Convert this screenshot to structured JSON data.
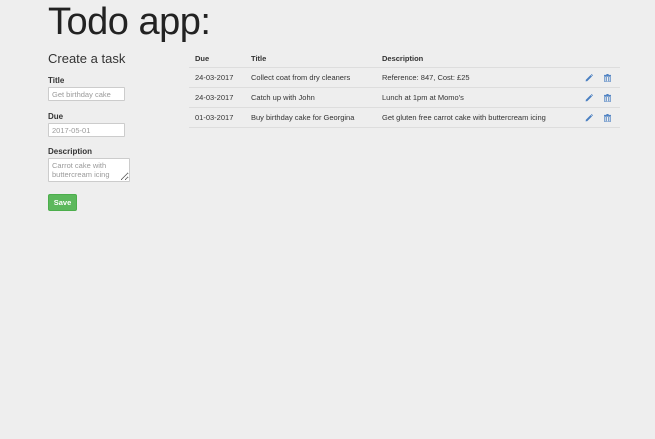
{
  "app": {
    "title": "Todo app:"
  },
  "form": {
    "heading": "Create a task",
    "title_label": "Title",
    "title_placeholder": "Get birthday cake",
    "due_label": "Due",
    "due_placeholder": "2017-05-01",
    "description_label": "Description",
    "description_placeholder": "Carrot cake with buttercream icing",
    "save_label": "Save",
    "save_color": "#5cb85c"
  },
  "table": {
    "headers": {
      "due": "Due",
      "title": "Title",
      "description": "Description"
    },
    "icons": {
      "edit": "pencil-icon",
      "delete": "trash-icon",
      "icon_color": "#4a7fc1"
    },
    "rows": [
      {
        "due": "24-03-2017",
        "title": "Collect coat from dry cleaners",
        "description": "Reference: 847, Cost: £25"
      },
      {
        "due": "24-03-2017",
        "title": "Catch up with John",
        "description": "Lunch at 1pm at Momo's"
      },
      {
        "due": "01-03-2017",
        "title": "Buy birthday cake for Georgina",
        "description": "Get gluten free carrot cake with buttercream icing"
      }
    ]
  }
}
